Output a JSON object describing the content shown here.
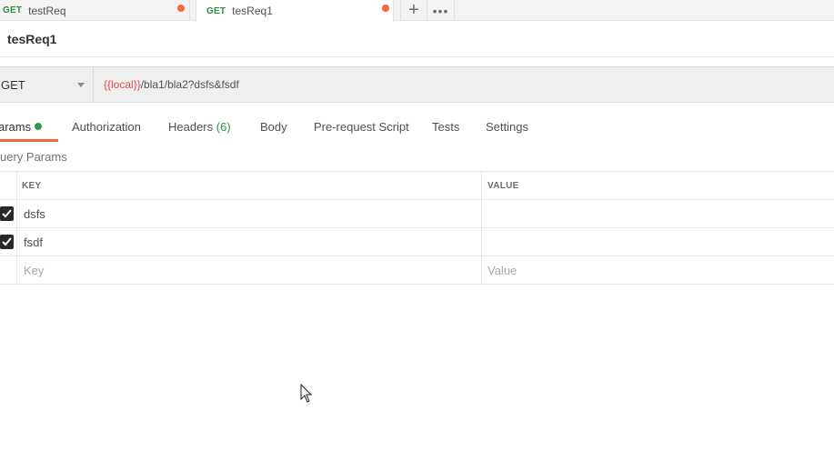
{
  "tabs": [
    {
      "method": "GET",
      "name": "testReq",
      "dot_color": "#f26b3a"
    },
    {
      "method": "GET",
      "name": "tesReq1",
      "dot_color": "#f26b3a"
    }
  ],
  "tab_actions": {
    "add_symbol": "+",
    "more_symbol": "•••"
  },
  "request": {
    "title": "tesReq1"
  },
  "urlbar": {
    "method": "GET",
    "url_variable": "{{local}}",
    "url_path": "/bla1/bla2?dsfs&fsdf"
  },
  "request_tabs": [
    {
      "label": "Params",
      "visible_text": "arams",
      "active": true,
      "indicator": "green-dot"
    },
    {
      "label": "Authorization"
    },
    {
      "label": "Headers",
      "count": "(6)"
    },
    {
      "label": "Body"
    },
    {
      "label": "Pre-request Script"
    },
    {
      "label": "Tests"
    },
    {
      "label": "Settings"
    }
  ],
  "query_params": {
    "title": "Query Params",
    "visible_title": "uery Params",
    "columns": {
      "key": "KEY",
      "value": "VALUE"
    },
    "rows": [
      {
        "checked": true,
        "key": "dsfs",
        "value": ""
      },
      {
        "checked": true,
        "key": "fsdf",
        "value": ""
      }
    ],
    "new_row": {
      "key_placeholder": "Key",
      "value_placeholder": "Value"
    }
  },
  "colors": {
    "accent": "#f26b3a",
    "method_get": "#2d8a3e",
    "count_green": "#2d9b49",
    "url_variable": "#e84a4a"
  }
}
